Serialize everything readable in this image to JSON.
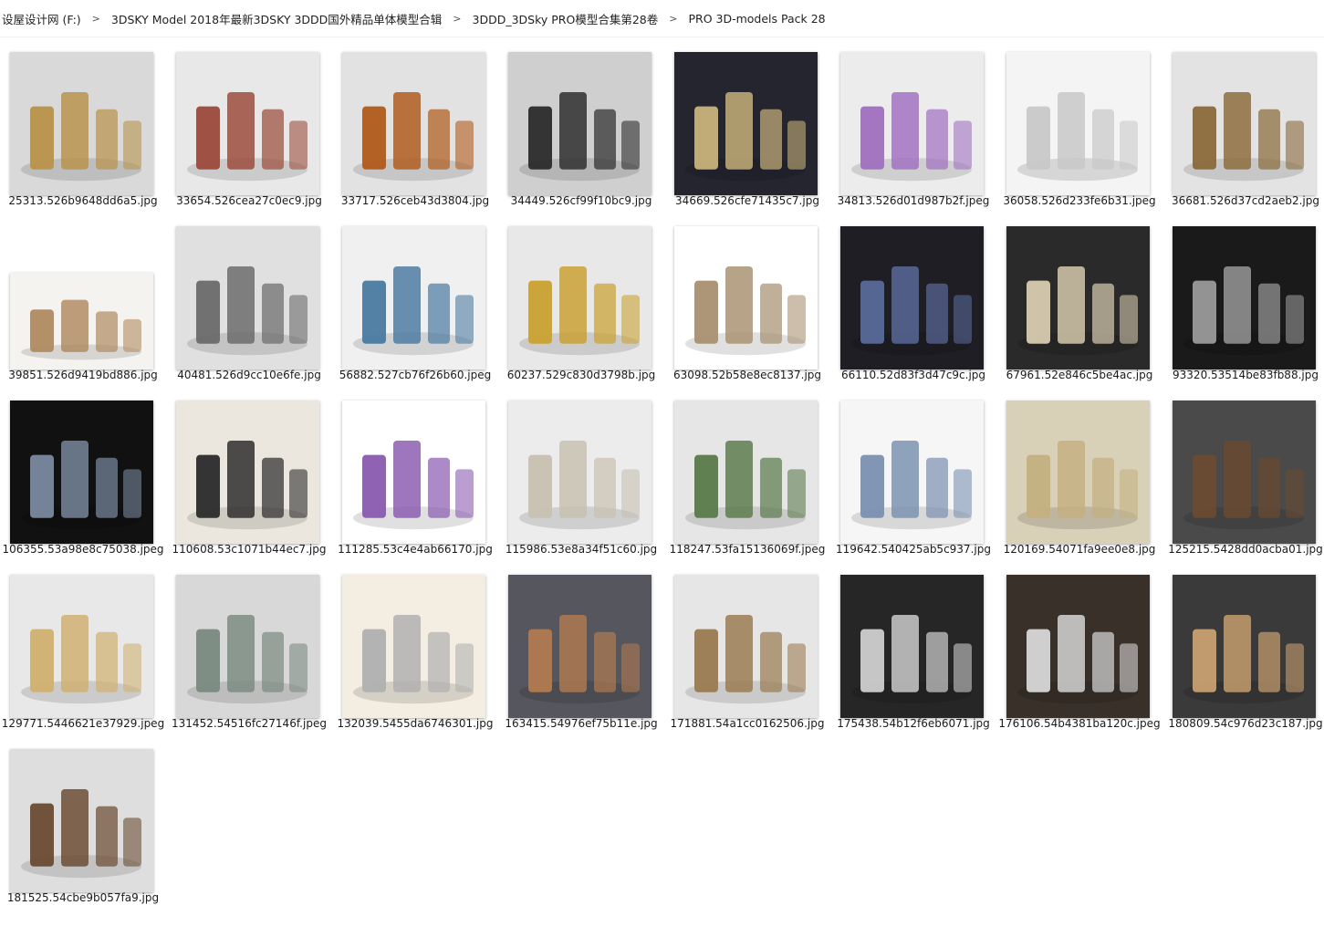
{
  "breadcrumb": [
    "设屋设计网 (F:)",
    "3DSKY Model 2018年最新3DSKY 3DDD国外精品单体模型合辑",
    "3DDD_3DSky PRO模型合集第28卷",
    "PRO 3D-models Pack 28"
  ],
  "files": [
    {
      "name": "25313.526b9648dd6a5.jpg",
      "bg": "#d9d9d9",
      "fg": "#b8924a",
      "h": 157
    },
    {
      "name": "33654.526cea27c0ec9.jpg",
      "bg": "#e8e8e8",
      "fg": "#9b4a3a",
      "h": 157
    },
    {
      "name": "33717.526ceb43d3804.jpg",
      "bg": "#e2e2e2",
      "fg": "#b05a1a",
      "h": 157
    },
    {
      "name": "34449.526cf99f10bc9.jpg",
      "bg": "#cfcfcf",
      "fg": "#2b2b2b",
      "h": 157
    },
    {
      "name": "34669.526cfe71435c7.jpg",
      "bg": "#252530",
      "fg": "#c9b27a",
      "h": 157
    },
    {
      "name": "34813.526d01d987b2f.jpeg",
      "bg": "#ececec",
      "fg": "#a070c0",
      "h": 157
    },
    {
      "name": "36058.526d233fe6b31.jpeg",
      "bg": "#f4f4f4",
      "fg": "#c8c8c8",
      "h": 157
    },
    {
      "name": "36681.526d37cd2aeb2.jpg",
      "bg": "#e3e3e3",
      "fg": "#8a6a3a",
      "h": 157
    },
    {
      "name": "39851.526d9419bd886.jpg",
      "bg": "#f5f3ef",
      "fg": "#b08a60",
      "h": 106
    },
    {
      "name": "40481.526d9cc10e6fe.jpg",
      "bg": "#e0e0e0",
      "fg": "#6a6a6a",
      "h": 157
    },
    {
      "name": "56882.527cb76f26b60.jpeg",
      "bg": "#f0f0f0",
      "fg": "#4a7aa0",
      "h": 157
    },
    {
      "name": "60237.529c830d3798b.jpg",
      "bg": "#e8e8e8",
      "fg": "#c9a030",
      "h": 157
    },
    {
      "name": "63098.52b58e8ec8137.jpg",
      "bg": "#ffffff",
      "fg": "#a89070",
      "h": 157
    },
    {
      "name": "66110.52d83f3d47c9c.jpg",
      "bg": "#1e1e24",
      "fg": "#5a6a9a",
      "h": 157
    },
    {
      "name": "67961.52e846c5be4ac.jpg",
      "bg": "#2a2a2a",
      "fg": "#d8ccb0",
      "h": 157
    },
    {
      "name": "93320.53514be83fb88.jpg",
      "bg": "#1a1a1a",
      "fg": "#9a9a9a",
      "h": 157
    },
    {
      "name": "106355.53a98e8c75038.jpeg",
      "bg": "#111111",
      "fg": "#7a8aa0",
      "h": 157
    },
    {
      "name": "110608.53c1071b44ec7.jpg",
      "bg": "#ebe7df",
      "fg": "#2a2a2a",
      "h": 157
    },
    {
      "name": "111285.53c4e4ab66170.jpg",
      "bg": "#ffffff",
      "fg": "#8a5ab0",
      "h": 157
    },
    {
      "name": "115986.53e8a34f51c60.jpg",
      "bg": "#ececec",
      "fg": "#c8c0b0",
      "h": 157
    },
    {
      "name": "118247.53fa15136069f.jpeg",
      "bg": "#e6e6e6",
      "fg": "#5a7a4a",
      "h": 157
    },
    {
      "name": "119642.540425ab5c937.jpg",
      "bg": "#f6f6f6",
      "fg": "#7a90b0",
      "h": 157
    },
    {
      "name": "120169.54071fa9ee0e8.jpg",
      "bg": "#d9d0b8",
      "fg": "#c4b080",
      "h": 157
    },
    {
      "name": "125215.5428dd0acba01.jpg",
      "bg": "#4a4a4a",
      "fg": "#6a4a30",
      "h": 157
    },
    {
      "name": "129771.5446621e37929.jpeg",
      "bg": "#e8e8e8",
      "fg": "#d0b070",
      "h": 157
    },
    {
      "name": "131452.54516fc27146f.jpeg",
      "bg": "#d8d8d8",
      "fg": "#7a8a80",
      "h": 157
    },
    {
      "name": "132039.5455da6746301.jpg",
      "bg": "#f3ede2",
      "fg": "#b0b0b0",
      "h": 157
    },
    {
      "name": "163415.54976ef75b11e.jpg",
      "bg": "#56565e",
      "fg": "#b07a50",
      "h": 157
    },
    {
      "name": "171881.54a1cc0162506.jpg",
      "bg": "#e6e6e6",
      "fg": "#9a7a50",
      "h": 157
    },
    {
      "name": "175438.54b12f6eb6071.jpg",
      "bg": "#262626",
      "fg": "#cfcfcf",
      "h": 157
    },
    {
      "name": "176106.54b4381ba120c.jpeg",
      "bg": "#3a302a",
      "fg": "#d8d8d8",
      "h": 157
    },
    {
      "name": "180809.54c976d23c187.jpg",
      "bg": "#3a3a3a",
      "fg": "#c8a070",
      "h": 157
    },
    {
      "name": "181525.54cbe9b057fa9.jpg",
      "bg": "#dedede",
      "fg": "#6a4a30",
      "h": 157
    }
  ]
}
